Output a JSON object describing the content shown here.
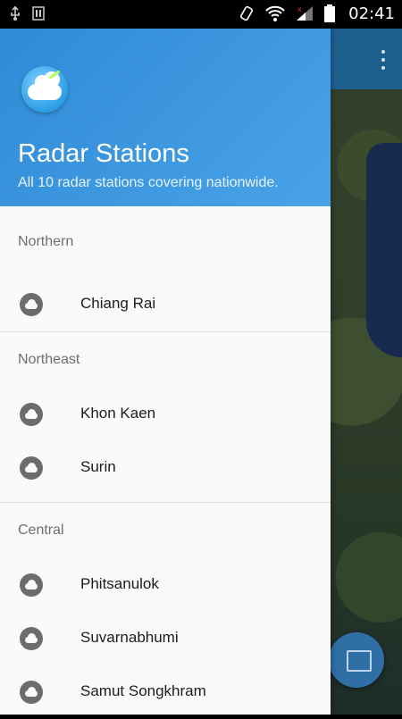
{
  "status_bar": {
    "time": "02:41"
  },
  "header": {
    "title": "Radar Stations",
    "subtitle": "All 10 radar stations covering nationwide."
  },
  "sections": [
    {
      "title": "Northern",
      "items": [
        {
          "label": "Chiang Rai"
        }
      ]
    },
    {
      "title": "Northeast",
      "items": [
        {
          "label": "Khon Kaen"
        },
        {
          "label": "Surin"
        }
      ]
    },
    {
      "title": "Central",
      "items": [
        {
          "label": "Phitsanulok"
        },
        {
          "label": "Suvarnabhumi"
        },
        {
          "label": "Samut Songkhram"
        }
      ]
    }
  ],
  "icons": {
    "station_icon": "cloud-icon",
    "app_logo": "radar-cloud-logo",
    "fab_icon": "map-icon",
    "overflow_icon": "overflow-menu-icon"
  },
  "colors": {
    "header_bg": "#3a97df",
    "fab_bg": "#2f6fa6"
  }
}
